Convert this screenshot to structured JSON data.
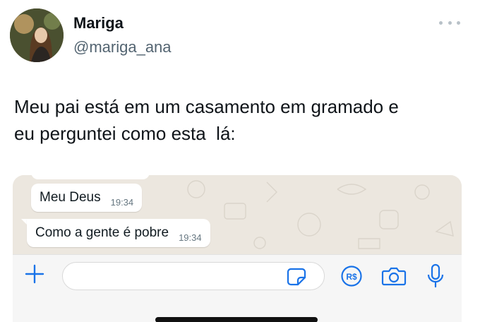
{
  "user": {
    "name": "Mariga",
    "handle": "@mariga_ana"
  },
  "tweet": {
    "lines": [
      "Meu pai está em um casamento em gramado e",
      "eu perguntei como esta  lá:"
    ]
  },
  "whatsapp": {
    "messages": [
      {
        "text": "Meu Deus",
        "time": "19:34"
      },
      {
        "text": "Como a gente é pobre",
        "time": "19:34"
      }
    ],
    "payment_symbol": "R$"
  },
  "colors": {
    "icon_blue": "#1a73e8",
    "chat_background": "#ece7df",
    "handle_gray": "#536471"
  },
  "icons": [
    "more-dots",
    "plus",
    "sticker",
    "payment-rs",
    "camera",
    "microphone"
  ]
}
